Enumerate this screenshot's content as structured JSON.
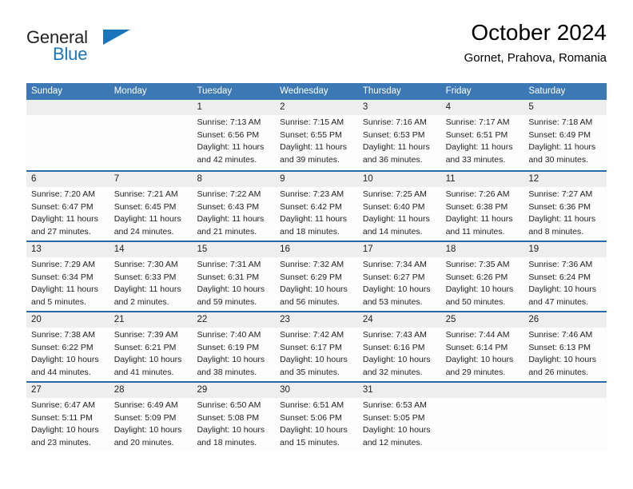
{
  "brand": {
    "name_part1": "General",
    "name_part2": "Blue",
    "flag_icon": "triangle-flag-icon",
    "color_dark": "#231f20",
    "color_blue": "#1b75bb"
  },
  "header": {
    "title": "October 2024",
    "subtitle": "Gornet, Prahova, Romania"
  },
  "theme": {
    "header_band": "#3c78b4",
    "row_divider": "#2b6aa8",
    "date_band": "#eeeeee",
    "cell_background": "#fdfdfd",
    "text": "#222222"
  },
  "calendar": {
    "day_names": [
      "Sunday",
      "Monday",
      "Tuesday",
      "Wednesday",
      "Thursday",
      "Friday",
      "Saturday"
    ],
    "weeks": [
      [
        {
          "day": "",
          "sunrise": "",
          "sunset": "",
          "daylight": ""
        },
        {
          "day": "",
          "sunrise": "",
          "sunset": "",
          "daylight": ""
        },
        {
          "day": "1",
          "sunrise": "Sunrise: 7:13 AM",
          "sunset": "Sunset: 6:56 PM",
          "daylight": "Daylight: 11 hours and 42 minutes."
        },
        {
          "day": "2",
          "sunrise": "Sunrise: 7:15 AM",
          "sunset": "Sunset: 6:55 PM",
          "daylight": "Daylight: 11 hours and 39 minutes."
        },
        {
          "day": "3",
          "sunrise": "Sunrise: 7:16 AM",
          "sunset": "Sunset: 6:53 PM",
          "daylight": "Daylight: 11 hours and 36 minutes."
        },
        {
          "day": "4",
          "sunrise": "Sunrise: 7:17 AM",
          "sunset": "Sunset: 6:51 PM",
          "daylight": "Daylight: 11 hours and 33 minutes."
        },
        {
          "day": "5",
          "sunrise": "Sunrise: 7:18 AM",
          "sunset": "Sunset: 6:49 PM",
          "daylight": "Daylight: 11 hours and 30 minutes."
        }
      ],
      [
        {
          "day": "6",
          "sunrise": "Sunrise: 7:20 AM",
          "sunset": "Sunset: 6:47 PM",
          "daylight": "Daylight: 11 hours and 27 minutes."
        },
        {
          "day": "7",
          "sunrise": "Sunrise: 7:21 AM",
          "sunset": "Sunset: 6:45 PM",
          "daylight": "Daylight: 11 hours and 24 minutes."
        },
        {
          "day": "8",
          "sunrise": "Sunrise: 7:22 AM",
          "sunset": "Sunset: 6:43 PM",
          "daylight": "Daylight: 11 hours and 21 minutes."
        },
        {
          "day": "9",
          "sunrise": "Sunrise: 7:23 AM",
          "sunset": "Sunset: 6:42 PM",
          "daylight": "Daylight: 11 hours and 18 minutes."
        },
        {
          "day": "10",
          "sunrise": "Sunrise: 7:25 AM",
          "sunset": "Sunset: 6:40 PM",
          "daylight": "Daylight: 11 hours and 14 minutes."
        },
        {
          "day": "11",
          "sunrise": "Sunrise: 7:26 AM",
          "sunset": "Sunset: 6:38 PM",
          "daylight": "Daylight: 11 hours and 11 minutes."
        },
        {
          "day": "12",
          "sunrise": "Sunrise: 7:27 AM",
          "sunset": "Sunset: 6:36 PM",
          "daylight": "Daylight: 11 hours and 8 minutes."
        }
      ],
      [
        {
          "day": "13",
          "sunrise": "Sunrise: 7:29 AM",
          "sunset": "Sunset: 6:34 PM",
          "daylight": "Daylight: 11 hours and 5 minutes."
        },
        {
          "day": "14",
          "sunrise": "Sunrise: 7:30 AM",
          "sunset": "Sunset: 6:33 PM",
          "daylight": "Daylight: 11 hours and 2 minutes."
        },
        {
          "day": "15",
          "sunrise": "Sunrise: 7:31 AM",
          "sunset": "Sunset: 6:31 PM",
          "daylight": "Daylight: 10 hours and 59 minutes."
        },
        {
          "day": "16",
          "sunrise": "Sunrise: 7:32 AM",
          "sunset": "Sunset: 6:29 PM",
          "daylight": "Daylight: 10 hours and 56 minutes."
        },
        {
          "day": "17",
          "sunrise": "Sunrise: 7:34 AM",
          "sunset": "Sunset: 6:27 PM",
          "daylight": "Daylight: 10 hours and 53 minutes."
        },
        {
          "day": "18",
          "sunrise": "Sunrise: 7:35 AM",
          "sunset": "Sunset: 6:26 PM",
          "daylight": "Daylight: 10 hours and 50 minutes."
        },
        {
          "day": "19",
          "sunrise": "Sunrise: 7:36 AM",
          "sunset": "Sunset: 6:24 PM",
          "daylight": "Daylight: 10 hours and 47 minutes."
        }
      ],
      [
        {
          "day": "20",
          "sunrise": "Sunrise: 7:38 AM",
          "sunset": "Sunset: 6:22 PM",
          "daylight": "Daylight: 10 hours and 44 minutes."
        },
        {
          "day": "21",
          "sunrise": "Sunrise: 7:39 AM",
          "sunset": "Sunset: 6:21 PM",
          "daylight": "Daylight: 10 hours and 41 minutes."
        },
        {
          "day": "22",
          "sunrise": "Sunrise: 7:40 AM",
          "sunset": "Sunset: 6:19 PM",
          "daylight": "Daylight: 10 hours and 38 minutes."
        },
        {
          "day": "23",
          "sunrise": "Sunrise: 7:42 AM",
          "sunset": "Sunset: 6:17 PM",
          "daylight": "Daylight: 10 hours and 35 minutes."
        },
        {
          "day": "24",
          "sunrise": "Sunrise: 7:43 AM",
          "sunset": "Sunset: 6:16 PM",
          "daylight": "Daylight: 10 hours and 32 minutes."
        },
        {
          "day": "25",
          "sunrise": "Sunrise: 7:44 AM",
          "sunset": "Sunset: 6:14 PM",
          "daylight": "Daylight: 10 hours and 29 minutes."
        },
        {
          "day": "26",
          "sunrise": "Sunrise: 7:46 AM",
          "sunset": "Sunset: 6:13 PM",
          "daylight": "Daylight: 10 hours and 26 minutes."
        }
      ],
      [
        {
          "day": "27",
          "sunrise": "Sunrise: 6:47 AM",
          "sunset": "Sunset: 5:11 PM",
          "daylight": "Daylight: 10 hours and 23 minutes."
        },
        {
          "day": "28",
          "sunrise": "Sunrise: 6:49 AM",
          "sunset": "Sunset: 5:09 PM",
          "daylight": "Daylight: 10 hours and 20 minutes."
        },
        {
          "day": "29",
          "sunrise": "Sunrise: 6:50 AM",
          "sunset": "Sunset: 5:08 PM",
          "daylight": "Daylight: 10 hours and 18 minutes."
        },
        {
          "day": "30",
          "sunrise": "Sunrise: 6:51 AM",
          "sunset": "Sunset: 5:06 PM",
          "daylight": "Daylight: 10 hours and 15 minutes."
        },
        {
          "day": "31",
          "sunrise": "Sunrise: 6:53 AM",
          "sunset": "Sunset: 5:05 PM",
          "daylight": "Daylight: 10 hours and 12 minutes."
        },
        {
          "day": "",
          "sunrise": "",
          "sunset": "",
          "daylight": ""
        },
        {
          "day": "",
          "sunrise": "",
          "sunset": "",
          "daylight": ""
        }
      ]
    ]
  }
}
